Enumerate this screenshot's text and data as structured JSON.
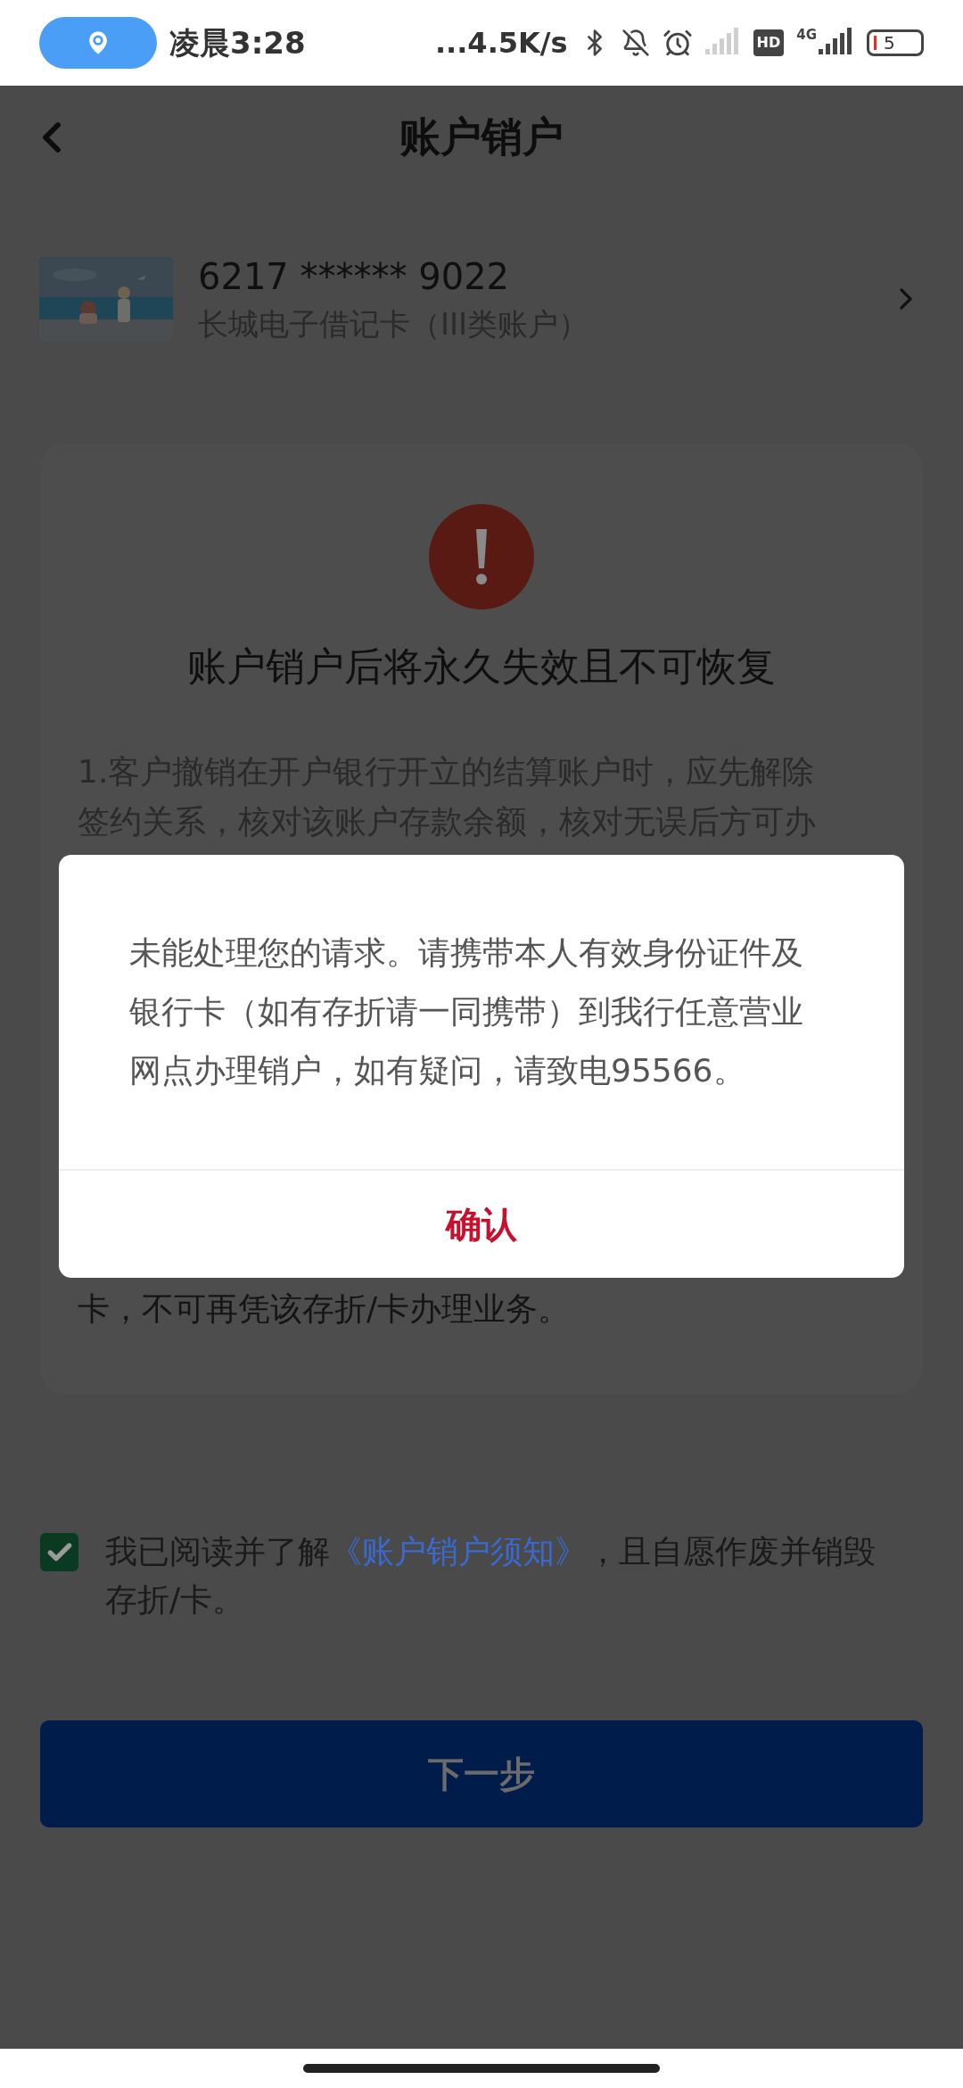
{
  "status_bar": {
    "time": "凌晨3:28",
    "network_speed": "...4.5K/s",
    "hd": "HD",
    "network_type": "4G",
    "battery": "5"
  },
  "header": {
    "title": "账户销户"
  },
  "account": {
    "number": "6217 ****** 9022",
    "type": "长城电子借记卡（III类账户）"
  },
  "notice": {
    "title": "账户销户后将永久失效且不可恢复",
    "lines_top": [
      "1.客户撤销在开户银行开立的结算账户时，应先解除",
      "签约关系，核对该账户存款余额，核对无误后方可办"
    ],
    "line_bottom": "卡，不可再凭该存折/卡办理业务。"
  },
  "agreement": {
    "checked": true,
    "text_before": "我已阅读并了解",
    "link": "《账户销户须知》",
    "text_after": "，且自愿作废并销毁存折/卡。"
  },
  "next_button": "下一步",
  "dialog": {
    "message": "未能处理您的请求。请携带本人有效身份证件及银行卡（如有存折请一同携带）到我行任意营业网点办理销户，如有疑问，请致电95566。",
    "confirm": "确认"
  }
}
